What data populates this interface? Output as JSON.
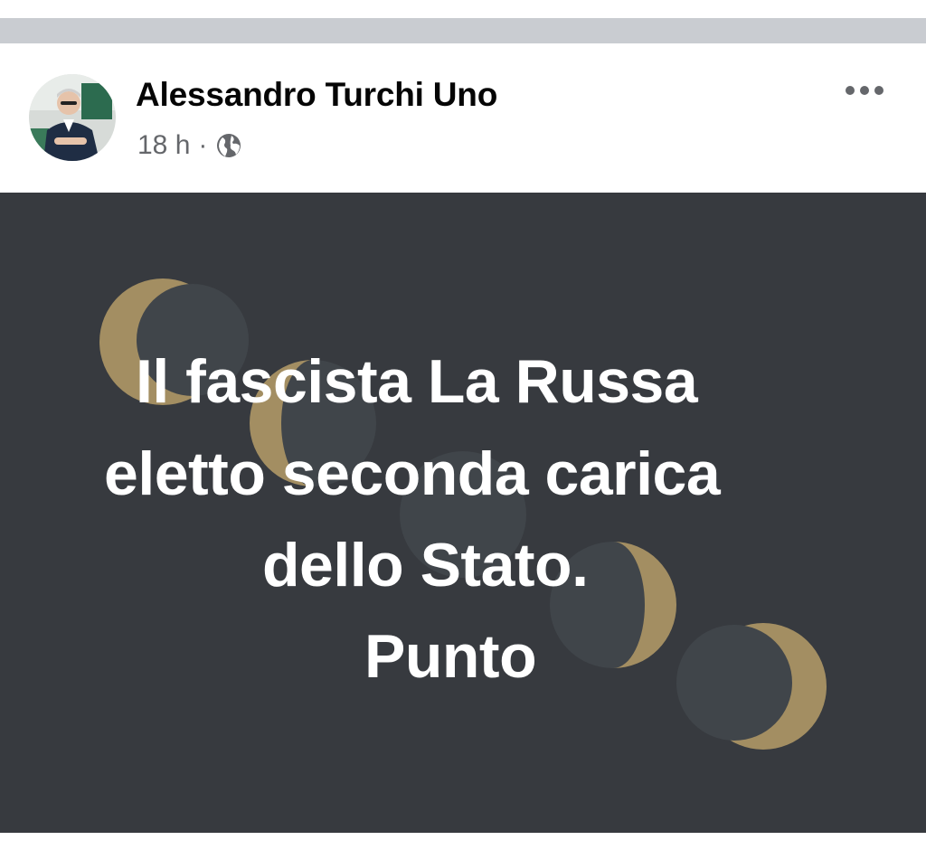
{
  "post": {
    "author": "Alessandro Turchi Uno",
    "timestamp": "18 h",
    "separator": "·",
    "privacy_icon": "globe-icon",
    "more_icon": "more-horizontal-icon",
    "image_text_lines": [
      "Il fascista La Russa",
      "eletto seconda carica",
      "dello Stato.",
      "Punto"
    ]
  },
  "colors": {
    "image_background": "#373a3f",
    "moon_gold": "#a38e62",
    "moon_shadow": "#40454a",
    "divider": "#c9ccd1",
    "meta_text": "#65676b"
  }
}
